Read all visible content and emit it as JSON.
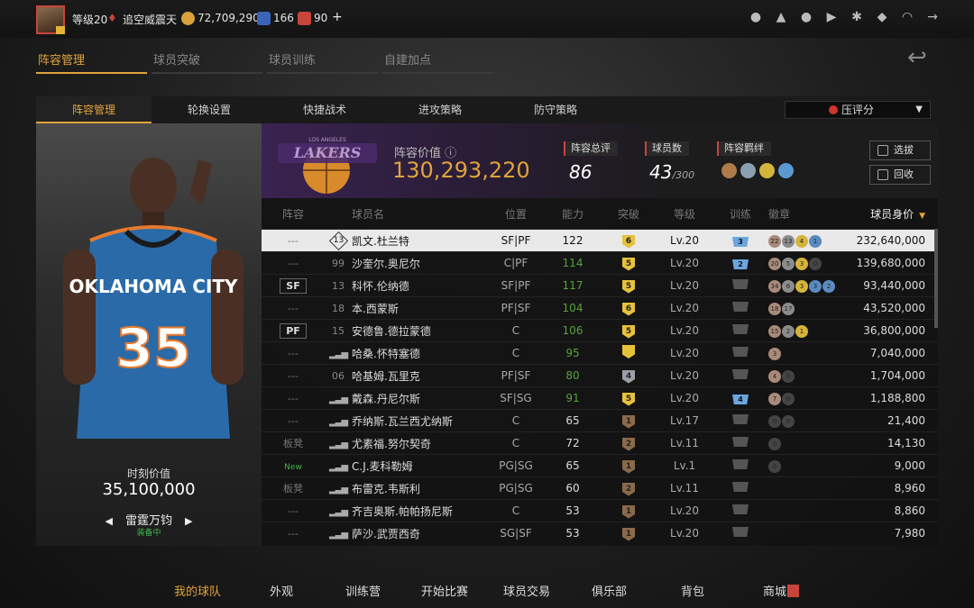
{
  "topbar": {
    "level": "等级20",
    "badge_name": "追空威震天",
    "coins": "72,709,290",
    "stars": "166",
    "points": "90",
    "plus": "+"
  },
  "main_tabs": [
    {
      "label": "阵容管理",
      "active": true
    },
    {
      "label": "球员突破",
      "active": false
    },
    {
      "label": "球员训练",
      "active": false
    },
    {
      "label": "自建加点",
      "active": false
    }
  ],
  "sub_tabs": [
    {
      "label": "阵容管理",
      "active": true
    },
    {
      "label": "轮换设置",
      "active": false
    },
    {
      "label": "快捷战术",
      "active": false
    },
    {
      "label": "进攻策略",
      "active": false
    },
    {
      "label": "防守策略",
      "active": false
    }
  ],
  "sort_select": {
    "value": "压评分"
  },
  "showcase": {
    "jersey_team": "OKLAHOMA CITY",
    "jersey_number": "35",
    "moment_label": "时刻价值",
    "moment_value": "35,100,000",
    "signature": "雷霆万钧",
    "equipped": "装备中"
  },
  "team": {
    "logo_text": "LOS ANGELES LAKERS",
    "value_label": "阵容价值",
    "value": "130,293,220",
    "rating_label": "阵容总评",
    "rating": "86",
    "count_label": "球员数",
    "count": "43",
    "count_max": "/300",
    "bond_label": "阵容羁绊",
    "btn_select": "选拔",
    "btn_recycle": "回收"
  },
  "table": {
    "headers": [
      "阵容",
      "球员名",
      "位置",
      "能力",
      "突破",
      "等级",
      "训练",
      "徽章",
      "球员身价"
    ],
    "rows": [
      {
        "lineup": "---",
        "num": "13",
        "name": "凯文.杜兰特",
        "pos": "SF|PF",
        "ability": "122",
        "green": false,
        "breakthrough": "6",
        "level": "Lv.20",
        "training": "3",
        "badges": [
          "22",
          "13",
          "4",
          "1"
        ],
        "price": "232,640,000"
      },
      {
        "lineup": "---",
        "num": "99",
        "name": "沙奎尔.奥尼尔",
        "pos": "C|PF",
        "ability": "114",
        "green": true,
        "breakthrough": "5",
        "level": "Lv.20",
        "training": "2",
        "badges": [
          "20",
          "5",
          "3",
          "0"
        ],
        "price": "139,680,000"
      },
      {
        "lineup": "SF",
        "num": "13",
        "name": "科怀.伦纳德",
        "pos": "SF|PF",
        "ability": "117",
        "green": true,
        "breakthrough": "5",
        "level": "Lv.20",
        "training": "",
        "badges": [
          "34",
          "6",
          "3",
          "3",
          "2"
        ],
        "price": "93,440,000"
      },
      {
        "lineup": "---",
        "num": "18",
        "name": "本.西蒙斯",
        "pos": "PF|SF",
        "ability": "104",
        "green": true,
        "breakthrough": "6",
        "level": "Lv.20",
        "training": "",
        "badges": [
          "18",
          "17"
        ],
        "price": "43,520,000"
      },
      {
        "lineup": "PF",
        "num": "15",
        "name": "安德鲁.德拉蒙德",
        "pos": "C",
        "ability": "106",
        "green": true,
        "breakthrough": "5",
        "level": "Lv.20",
        "training": "",
        "badges": [
          "15",
          "2",
          "1"
        ],
        "price": "36,800,000"
      },
      {
        "lineup": "---",
        "num": "",
        "name": "哈桑.怀特塞德",
        "pos": "C",
        "ability": "95",
        "green": true,
        "breakthrough": "",
        "level": "Lv.20",
        "training": "",
        "badges": [
          "3"
        ],
        "price": "7,040,000"
      },
      {
        "lineup": "---",
        "num": "06",
        "name": "哈基姆.瓦里克",
        "pos": "PF|SF",
        "ability": "80",
        "green": true,
        "breakthrough": "4",
        "level": "Lv.20",
        "training": "",
        "badges": [
          "4",
          "0"
        ],
        "price": "1,704,000"
      },
      {
        "lineup": "---",
        "num": "",
        "name": "戴森.丹尼尔斯",
        "pos": "SF|SG",
        "ability": "91",
        "green": true,
        "breakthrough": "5",
        "level": "Lv.20",
        "training": "4",
        "badges": [
          "7",
          "0"
        ],
        "price": "1,188,800"
      },
      {
        "lineup": "---",
        "num": "",
        "name": "乔纳斯.瓦兰西尤纳斯",
        "pos": "C",
        "ability": "65",
        "green": false,
        "breakthrough": "1",
        "level": "Lv.17",
        "training": "",
        "badges": [
          "0",
          "0"
        ],
        "price": "21,400"
      },
      {
        "lineup": "板凳",
        "num": "",
        "name": "尤素福.努尔契奇",
        "pos": "C",
        "ability": "72",
        "green": false,
        "breakthrough": "2",
        "level": "Lv.11",
        "training": "",
        "badges": [
          "0"
        ],
        "price": "14,130"
      },
      {
        "lineup": "",
        "new": "New",
        "num": "",
        "name": "C.J.麦科勒姆",
        "pos": "PG|SG",
        "ability": "65",
        "green": false,
        "breakthrough": "1",
        "level": "Lv.1",
        "training": "",
        "badges": [
          "0"
        ],
        "price": "9,000"
      },
      {
        "lineup": "板凳",
        "num": "",
        "name": "布雷克.韦斯利",
        "pos": "PG|SG",
        "ability": "60",
        "green": false,
        "breakthrough": "2",
        "level": "Lv.11",
        "training": "",
        "badges": [],
        "price": "8,960"
      },
      {
        "lineup": "---",
        "num": "",
        "name": "齐吉奥斯.帕帕扬尼斯",
        "pos": "C",
        "ability": "53",
        "green": false,
        "breakthrough": "1",
        "level": "Lv.20",
        "training": "",
        "badges": [],
        "price": "8,860"
      },
      {
        "lineup": "---",
        "num": "",
        "name": "萨沙.武贾西奇",
        "pos": "SG|SF",
        "ability": "53",
        "green": false,
        "breakthrough": "1",
        "level": "Lv.20",
        "training": "",
        "badges": [],
        "price": "7,980"
      }
    ]
  },
  "bottom_nav": [
    {
      "label": "我的球队",
      "active": true
    },
    {
      "label": "外观",
      "active": false
    },
    {
      "label": "训练营",
      "active": false
    },
    {
      "label": "开始比赛",
      "active": false
    },
    {
      "label": "球员交易",
      "active": false
    },
    {
      "label": "俱乐部",
      "active": false
    },
    {
      "label": "背包",
      "active": false
    },
    {
      "label": "商城",
      "active": false
    }
  ],
  "colors": {
    "accent": "#e1a33a",
    "green": "#5aa23c",
    "red": "#c8453c"
  }
}
